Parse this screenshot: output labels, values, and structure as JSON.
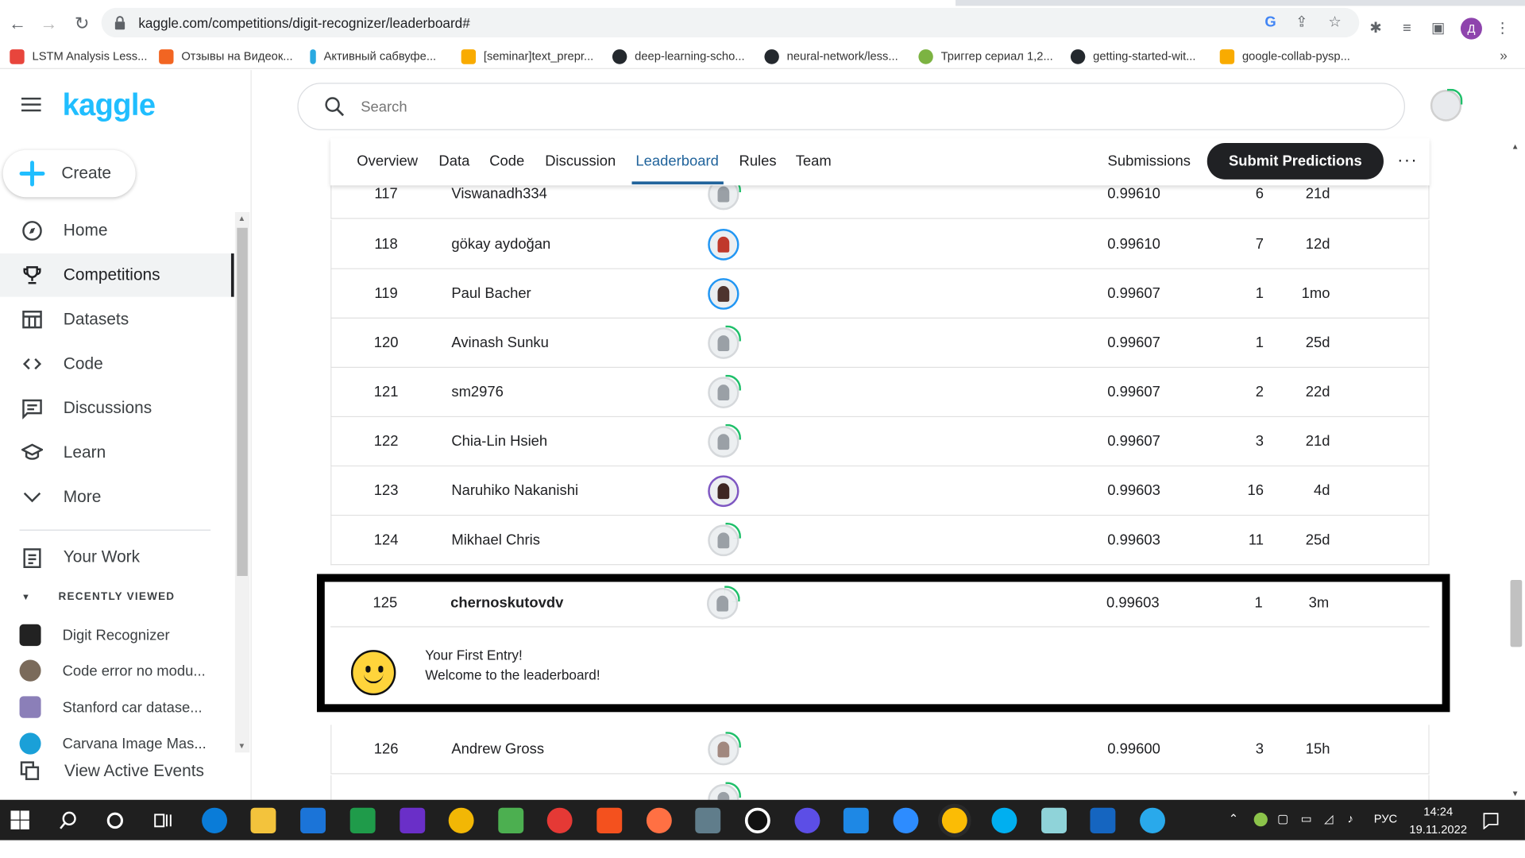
{
  "browser": {
    "url": "kaggle.com/competitions/digit-recognizer/leaderboard#",
    "profile_initial": "Д",
    "bookmarks": [
      {
        "label": "LSTM Analysis Less...",
        "color": "#e8453c"
      },
      {
        "label": "Отзывы на Видеок...",
        "color": "#f26522"
      },
      {
        "label": "Активный сабвуфе...",
        "color": "#29a9e1"
      },
      {
        "label": "[seminar]text_prepr...",
        "color": "#f9ab00"
      },
      {
        "label": "deep-learning-scho...",
        "color": "#24292e"
      },
      {
        "label": "neural-network/less...",
        "color": "#24292e"
      },
      {
        "label": "Триггер сериал 1,2...",
        "color": "#7cb342"
      },
      {
        "label": "getting-started-wit...",
        "color": "#24292e"
      },
      {
        "label": "google-collab-pysp...",
        "color": "#f9ab00"
      }
    ],
    "bookmarks_more": "»"
  },
  "sidebar": {
    "logo": "kaggle",
    "create_label": "Create",
    "nav": [
      {
        "label": "Home",
        "icon": "compass-icon"
      },
      {
        "label": "Competitions",
        "icon": "trophy-icon"
      },
      {
        "label": "Datasets",
        "icon": "table-icon"
      },
      {
        "label": "Code",
        "icon": "code-icon"
      },
      {
        "label": "Discussions",
        "icon": "comment-icon"
      },
      {
        "label": "Learn",
        "icon": "school-icon"
      },
      {
        "label": "More",
        "icon": "chevron-down-icon"
      }
    ],
    "your_work": "Your Work",
    "recently_viewed_header": "RECENTLY VIEWED",
    "recent": [
      {
        "label": "Digit Recognizer"
      },
      {
        "label": "Code error no modu..."
      },
      {
        "label": "Stanford car datase..."
      },
      {
        "label": "Carvana Image Mas..."
      }
    ],
    "view_active_events": "View Active Events"
  },
  "search": {
    "placeholder": "Search"
  },
  "tabs": {
    "items": [
      "Overview",
      "Data",
      "Code",
      "Discussion",
      "Leaderboard",
      "Rules",
      "Team"
    ],
    "active": "Leaderboard",
    "submissions": "Submissions",
    "submit": "Submit Predictions",
    "more": "···"
  },
  "leaderboard": {
    "rows": [
      {
        "rank": "117",
        "team": "Viswanadh334",
        "score": "0.99610",
        "entries": "6",
        "last": "21d",
        "avatar": "default"
      },
      {
        "rank": "118",
        "team": "gökay aydoğan",
        "score": "0.99610",
        "entries": "7",
        "last": "12d",
        "avatar": "blue"
      },
      {
        "rank": "119",
        "team": "Paul Bacher",
        "score": "0.99607",
        "entries": "1",
        "last": "1mo",
        "avatar": "blue"
      },
      {
        "rank": "120",
        "team": "Avinash Sunku",
        "score": "0.99607",
        "entries": "1",
        "last": "25d",
        "avatar": "default"
      },
      {
        "rank": "121",
        "team": "sm2976",
        "score": "0.99607",
        "entries": "2",
        "last": "22d",
        "avatar": "default"
      },
      {
        "rank": "122",
        "team": "Chia-Lin Hsieh",
        "score": "0.99607",
        "entries": "3",
        "last": "21d",
        "avatar": "default"
      },
      {
        "rank": "123",
        "team": "Naruhiko Nakanishi",
        "score": "0.99603",
        "entries": "16",
        "last": "4d",
        "avatar": "purple"
      },
      {
        "rank": "124",
        "team": "Mikhael Chris",
        "score": "0.99603",
        "entries": "11",
        "last": "25d",
        "avatar": "default"
      }
    ],
    "highlight": {
      "rank": "125",
      "team": "chernoskutovdv",
      "score": "0.99603",
      "entries": "1",
      "last": "3m",
      "message_line1": "Your First Entry!",
      "message_line2": "Welcome to the leaderboard!"
    },
    "after_rows": [
      {
        "rank": "126",
        "team": "Andrew Gross",
        "score": "0.99600",
        "entries": "3",
        "last": "15h",
        "avatar": "default"
      }
    ]
  },
  "taskbar": {
    "language": "РУС",
    "time": "14:24",
    "date": "19.11.2022"
  }
}
